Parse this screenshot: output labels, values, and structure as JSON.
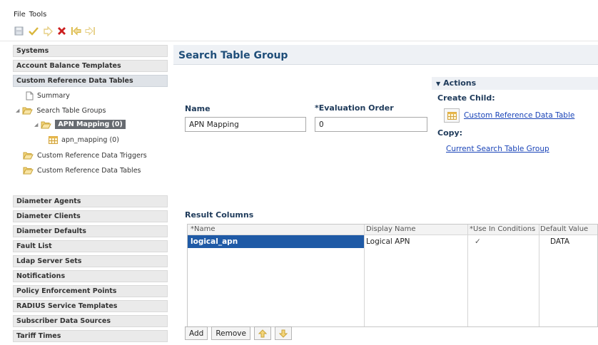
{
  "menu": {
    "file": "File",
    "tools": "Tools"
  },
  "toolbar": {
    "icons": [
      "save-icon",
      "check-icon",
      "apply-icon",
      "delete-icon",
      "back-icon",
      "forward-icon"
    ]
  },
  "nav": {
    "sections_top": [
      "Systems",
      "Account Balance Templates",
      "Custom Reference Data Tables"
    ],
    "tree": {
      "summary": "Summary",
      "search_table_groups": "Search Table Groups",
      "apn_mapping": "APN Mapping (0)",
      "apn_mapping_table": "apn_mapping (0)",
      "triggers": "Custom Reference Data Triggers",
      "tables": "Custom Reference Data Tables"
    },
    "sections_bottom": [
      "Diameter Agents",
      "Diameter Clients",
      "Diameter Defaults",
      "Fault List",
      "Ldap Server Sets",
      "Notifications",
      "Policy Enforcement Points",
      "RADIUS Service Templates",
      "Subscriber Data Sources",
      "Tariff Times"
    ]
  },
  "main": {
    "title": "Search Table Group",
    "name_label": "Name",
    "name_value": "APN Mapping",
    "eval_label": "*Evaluation Order",
    "eval_value": "0",
    "actions": {
      "header": "Actions",
      "create_child": "Create Child:",
      "create_child_link": "Custom Reference Data Table",
      "copy": "Copy:",
      "copy_link": "Current Search Table Group"
    },
    "result_columns_label": "Result Columns",
    "columns": [
      "*Name",
      "Display Name",
      "*Use In Conditions",
      "Default Value"
    ],
    "rows": [
      {
        "name": "logical_apn",
        "display": "Logical APN",
        "use_in_conditions": "✓",
        "default": "DATA"
      }
    ],
    "buttons": {
      "add": "Add",
      "remove": "Remove"
    }
  },
  "colors": {
    "accent": "#1f4e79",
    "link": "#1a44b8",
    "selected_row": "#1f5aa6",
    "selected_node": "#666a70"
  }
}
